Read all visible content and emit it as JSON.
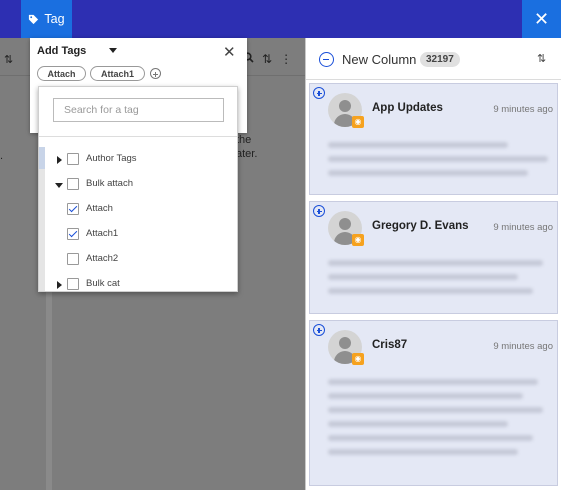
{
  "topbar": {
    "tag_label": "Tag",
    "close_glyph": "✕",
    "accent": "#1a6fe0",
    "bar_color": "#2d2fb2"
  },
  "background": {
    "text_line1": "the",
    "text_line2": "ater.",
    "left_dot": ".",
    "sort_glyph": "⇅",
    "more_glyph": "⋮"
  },
  "column": {
    "title": "New Column",
    "count": "32197",
    "sort_glyph": "⇅",
    "cards": [
      {
        "name": "App Updates",
        "time": "9 minutes ago"
      },
      {
        "name": "Gregory D. Evans",
        "time": "9 minutes ago"
      },
      {
        "name": "Cris87",
        "time": "9 minutes ago"
      }
    ]
  },
  "add_tags": {
    "title": "Add Tags",
    "close_glyph": "✕",
    "chips": [
      "Attach",
      "Attach1"
    ],
    "search_placeholder": "Search for a tag",
    "items": [
      {
        "label": "Author Tags",
        "expander": "collapsed",
        "checked": false
      },
      {
        "label": "Bulk attach",
        "expander": "expanded",
        "checked": false
      },
      {
        "label": "Attach",
        "expander": "none",
        "checked": true
      },
      {
        "label": "Attach1",
        "expander": "none",
        "checked": true
      },
      {
        "label": "Attach2",
        "expander": "none",
        "checked": false
      },
      {
        "label": "Bulk cat",
        "expander": "collapsed",
        "checked": false
      }
    ]
  }
}
